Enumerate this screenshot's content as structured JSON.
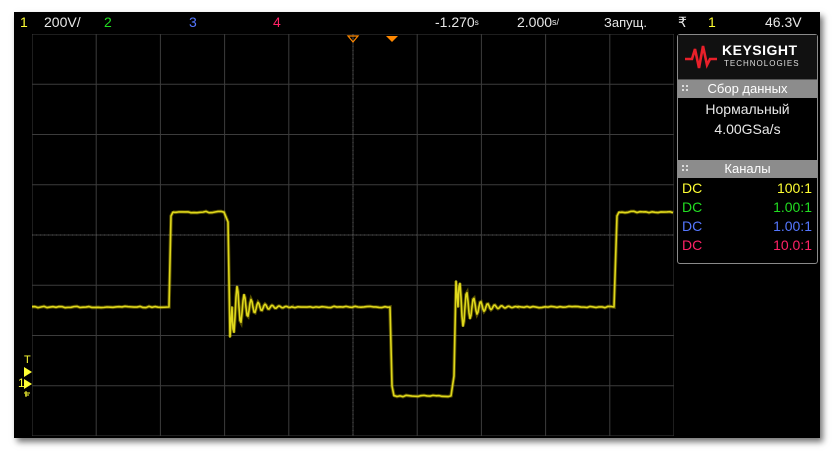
{
  "topbar": {
    "ch1_num": "1",
    "ch1_scale": "200V/",
    "ch2_num": "2",
    "ch3_num": "3",
    "ch4_num": "4",
    "time_offset": "-1.270",
    "time_offset_unit": "s",
    "time_scale": "2.000",
    "time_scale_unit": "s/",
    "run_state": "Запущ.",
    "trigger_symbol": "₹",
    "trigger_channel": "1",
    "trigger_level": "46.3V"
  },
  "brand": {
    "name": "KEYSIGHT",
    "sub": "TECHNOLOGIES"
  },
  "acquisition": {
    "title": "Сбор данных",
    "mode": "Нормальный",
    "rate": "4.00GSa/s"
  },
  "channels": {
    "title": "Каналы",
    "rows": [
      {
        "coupling": "DC",
        "probe": "100:1",
        "color": "#ffff33"
      },
      {
        "coupling": "DC",
        "probe": "1.00:1",
        "color": "#22dd22"
      },
      {
        "coupling": "DC",
        "probe": "1.00:1",
        "color": "#5577ff"
      },
      {
        "coupling": "DC",
        "probe": "10.0:1",
        "color": "#ff2266"
      }
    ]
  },
  "markers": {
    "trigger_level_label": "T",
    "ch1_ground_label": "1"
  },
  "colors": {
    "ch1": "#ffff33",
    "ch2": "#22dd22",
    "ch3": "#5577ff",
    "ch4": "#ff2266",
    "trigger_marker": "#ff8800",
    "panel_header": "#8c8c8c",
    "brand_logo": "#e8202a"
  }
}
